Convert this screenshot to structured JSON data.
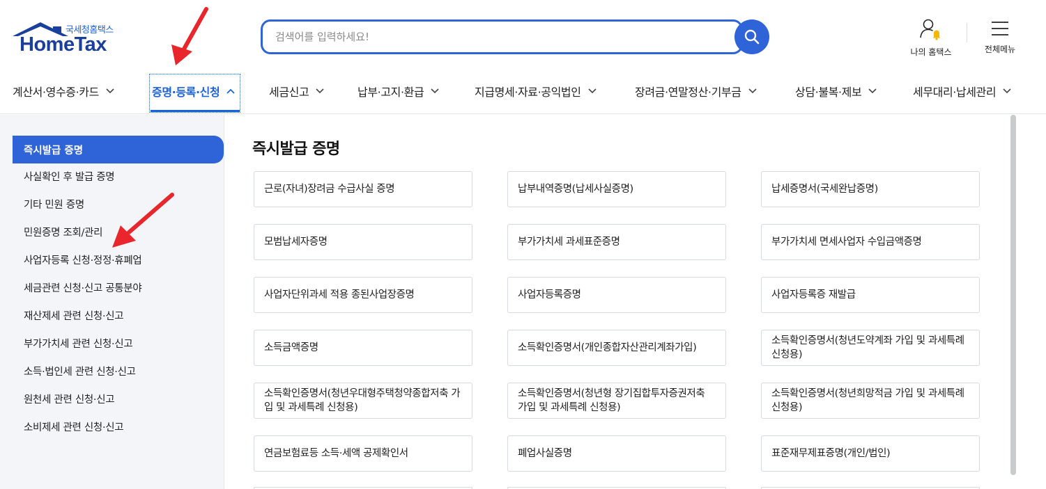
{
  "header": {
    "logo_sub": "국세청홈택스",
    "logo_main": "HomeTax",
    "search_placeholder": "검색어를 입력하세요!",
    "my_hometax_label": "나의 홈택스",
    "all_menu_label": "전체메뉴"
  },
  "gnb": {
    "items": [
      {
        "label": "계산서·영수증·카드"
      },
      {
        "label": "증명·등록·신청"
      },
      {
        "label": "세금신고"
      },
      {
        "label": "납부·고지·환급"
      },
      {
        "label": "지급명세·자료·공익법인"
      },
      {
        "label": "장려금·연말정산·기부금"
      },
      {
        "label": "상담·불복·제보"
      },
      {
        "label": "세무대리·납세관리"
      }
    ],
    "active_index": 1
  },
  "sidebar": {
    "items": [
      {
        "label": "즉시발급 증명"
      },
      {
        "label": "사실확인 후 발급 증명"
      },
      {
        "label": "기타 민원 증명"
      },
      {
        "label": "민원증명 조회/관리"
      },
      {
        "label": "사업자등록 신청·정정·휴폐업"
      },
      {
        "label": "세금관련 신청·신고 공통분야"
      },
      {
        "label": "재산제세 관련 신청·신고"
      },
      {
        "label": "부가가치세 관련 신청·신고"
      },
      {
        "label": "소득·법인세 관련 신청·신고"
      },
      {
        "label": "원천세 관련 신청·신고"
      },
      {
        "label": "소비제세 관련 신청·신고"
      }
    ]
  },
  "main": {
    "title": "즉시발급 증명",
    "cards": [
      {
        "label": "근로(자녀)장려금 수급사실 증명"
      },
      {
        "label": "납부내역증명(납세사실증명)"
      },
      {
        "label": "납세증명서(국세완납증명)"
      },
      {
        "label": "모범납세자증명"
      },
      {
        "label": "부가가치세 과세표준증명"
      },
      {
        "label": "부가가치세 면세사업자 수입금액증명"
      },
      {
        "label": "사업자단위과세 적용 종된사업장증명"
      },
      {
        "label": "사업자등록증명"
      },
      {
        "label": "사업자등록증 재발급"
      },
      {
        "label": "소득금액증명"
      },
      {
        "label": "소득확인증명서(개인종합자산관리계좌가입)"
      },
      {
        "label": "소득확인증명서(청년도약계좌 가입 및 과세특례 신청용)"
      },
      {
        "label": "소득확인증명서(청년우대형주택청약종합저축 가입 및 과세특례 신청용)"
      },
      {
        "label": "소득확인증명서(청년형 장기집합투자증권저축 가입 및 과세특례 신청용)"
      },
      {
        "label": "소득확인증명서(청년희망적금 가입 및 과세특례 신청용)"
      },
      {
        "label": "연금보험료등 소득·세액 공제확인서"
      },
      {
        "label": "폐업사실증명"
      },
      {
        "label": "표준재무제표증명(개인/법인)"
      }
    ]
  },
  "colors": {
    "primary": "#2f63d8",
    "brand_dark": "#1a3f9c",
    "annotation_arrow": "#e8262b"
  }
}
